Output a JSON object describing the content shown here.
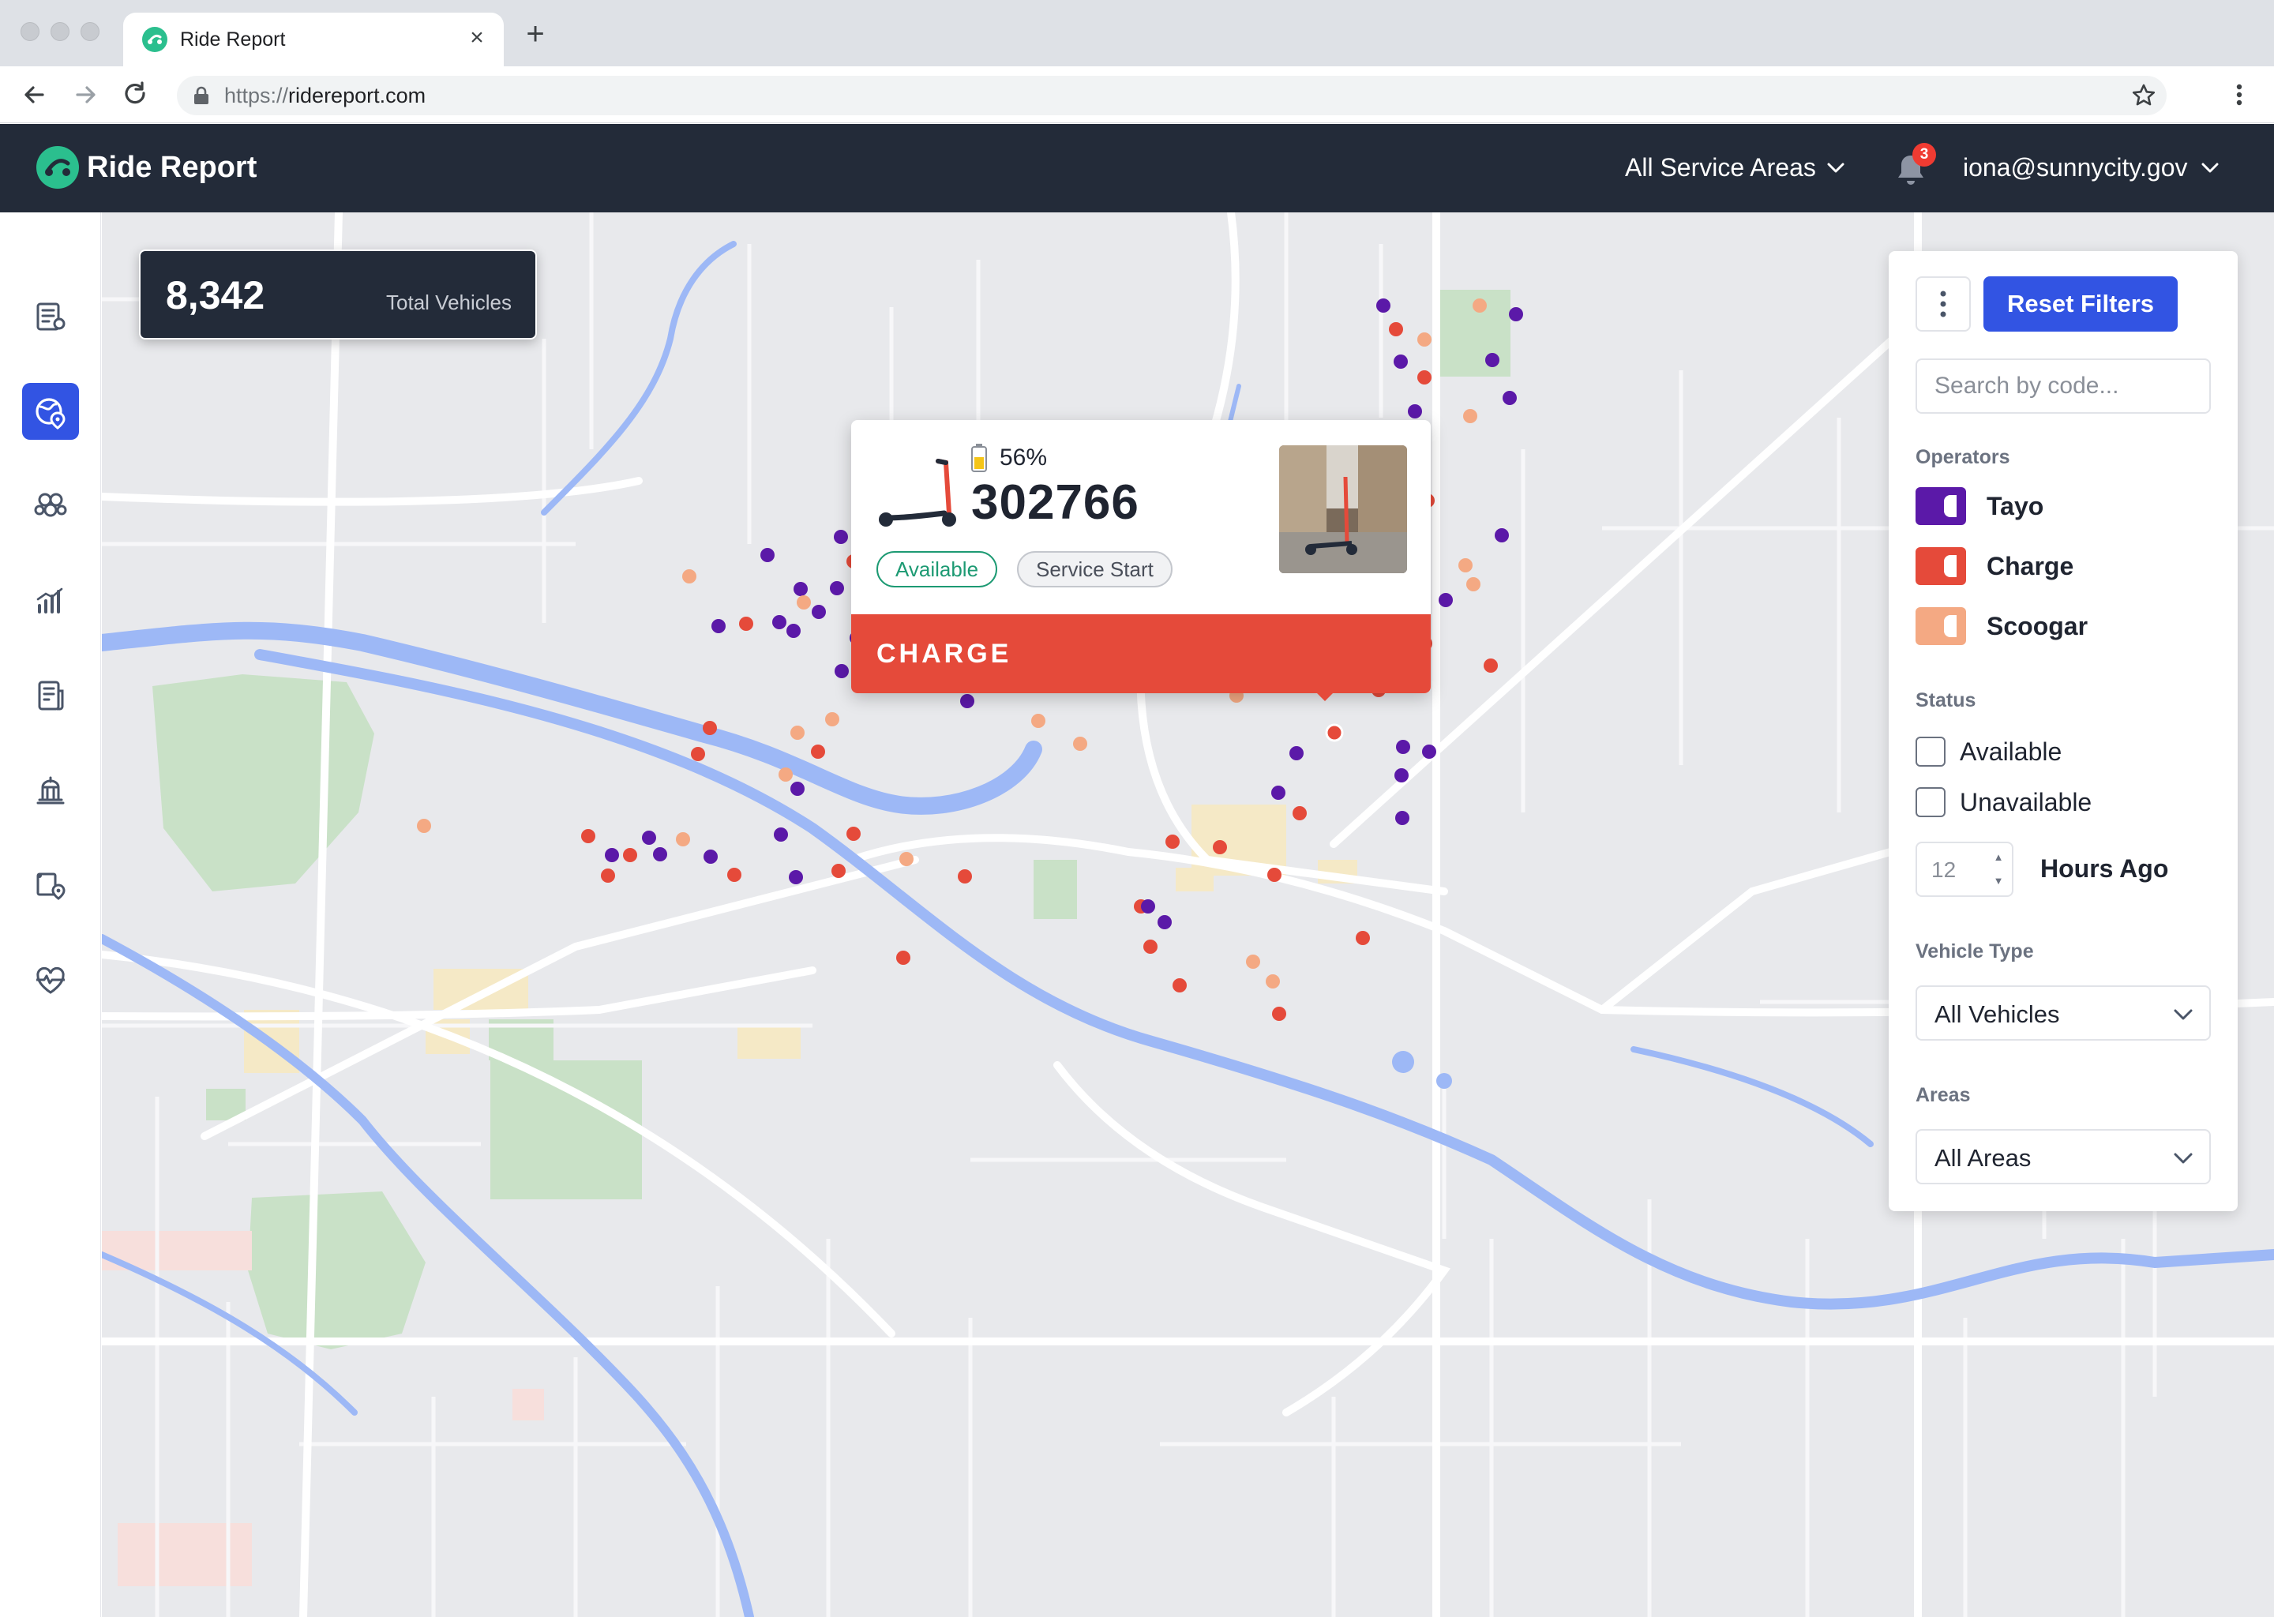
{
  "browser": {
    "tab_title": "Ride Report",
    "tab_close": "×",
    "new_tab": "+",
    "url_protocol": "https://",
    "url_host": "ridereport.com"
  },
  "app": {
    "brand": "Ride Report",
    "service_area": "All Service Areas",
    "notification_count": "3",
    "user_email": "iona@sunnycity.gov"
  },
  "sidebar": {
    "items": [
      {
        "icon": "trips-report-icon",
        "active": false
      },
      {
        "icon": "map-location-icon",
        "active": true
      },
      {
        "icon": "hexbin-icon",
        "active": false
      },
      {
        "icon": "bar-chart-icon",
        "active": false
      },
      {
        "icon": "document-report-icon",
        "active": false
      },
      {
        "icon": "city-hall-icon",
        "active": false
      },
      {
        "icon": "route-pin-icon",
        "active": false
      },
      {
        "icon": "health-pulse-icon",
        "active": false
      }
    ]
  },
  "summary": {
    "total_value": "8,342",
    "total_label": "Total Vehicles"
  },
  "popup": {
    "battery": "56%",
    "vehicle_id": "302766",
    "status_pill": "Available",
    "event_pill": "Service Start",
    "operator": "CHARGE"
  },
  "filters": {
    "reset_label": "Reset Filters",
    "search_placeholder": "Search by code...",
    "operators_label": "Operators",
    "operators": [
      {
        "name": "Tayo",
        "color": "#5b19a8"
      },
      {
        "name": "Charge",
        "color": "#e54a3a"
      },
      {
        "name": "Scoogar",
        "color": "#f4a983"
      }
    ],
    "status_label": "Status",
    "status_options": [
      "Available",
      "Unavailable"
    ],
    "hours_value": "12",
    "hours_label": "Hours Ago",
    "vehicle_type_label": "Vehicle Type",
    "vehicle_type_value": "All Vehicles",
    "areas_label": "Areas",
    "areas_value": "All Areas"
  },
  "colors": {
    "accent": "#3254e3",
    "header": "#232b39",
    "brand_green": "#2bbf8e",
    "tayo": "#5b19a8",
    "charge": "#e54a3a",
    "scoogar": "#f4a983",
    "available": "#1d9a73"
  }
}
